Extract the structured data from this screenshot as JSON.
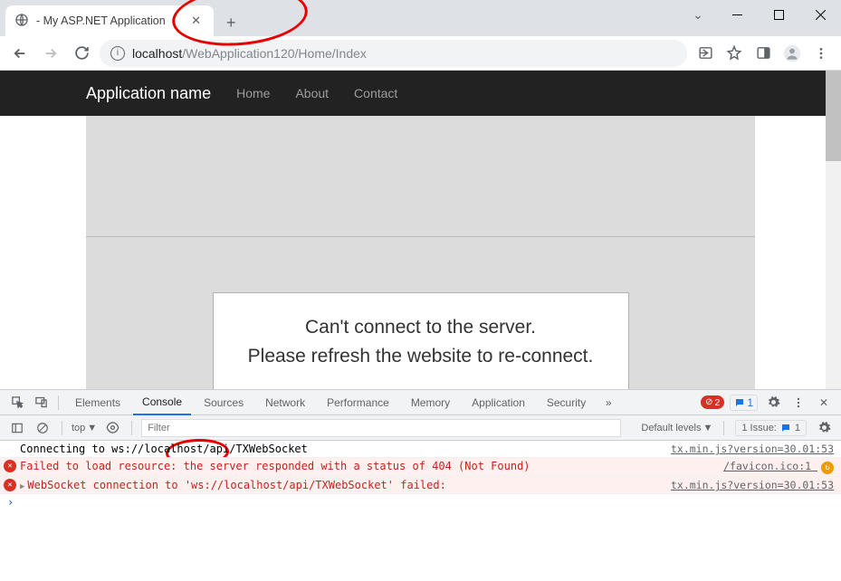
{
  "window": {
    "tab_title": " - My ASP.NET Application"
  },
  "toolbar": {
    "url_host": "localhost",
    "url_path": "/WebApplication120/Home/Index"
  },
  "page": {
    "brand": "Application name",
    "nav": [
      "Home",
      "About",
      "Contact"
    ],
    "modal_line1": "Can't connect to the server.",
    "modal_line2": "Please refresh the website to re-connect."
  },
  "devtools": {
    "tabs": [
      "Elements",
      "Console",
      "Sources",
      "Network",
      "Performance",
      "Memory",
      "Application",
      "Security"
    ],
    "active_tab": "Console",
    "error_count": "2",
    "message_count": "1",
    "top_context": "top",
    "filter_placeholder": "Filter",
    "default_levels": "Default levels",
    "issues_label": "1 Issue:",
    "issues_count": "1",
    "lines": [
      {
        "type": "log",
        "msg": "Connecting to ws://localhost/api/TXWebSocket",
        "src": "tx.min.js?version=30.01:53"
      },
      {
        "type": "err",
        "msg": "Failed to load resource: the server responded with a status of 404 (Not Found)",
        "src": "/favicon.ico:1",
        "warn": true
      },
      {
        "type": "err",
        "msg": "WebSocket connection to 'ws://localhost/api/TXWebSocket' failed:",
        "src": "tx.min.js?version=30.01:53",
        "expandable": true
      }
    ]
  }
}
